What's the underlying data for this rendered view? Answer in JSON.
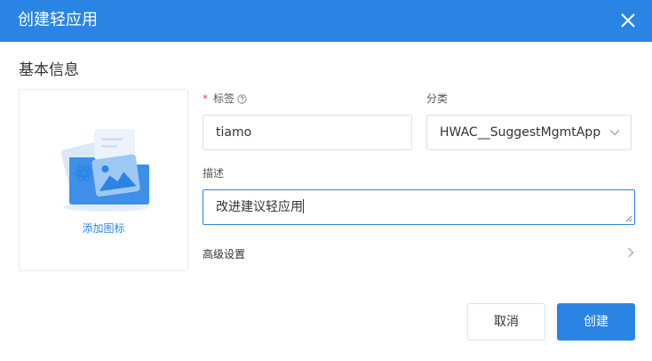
{
  "dialog": {
    "title": "创建轻应用"
  },
  "section": {
    "basic_info": "基本信息"
  },
  "icon_upload": {
    "label": "添加图标"
  },
  "form": {
    "tag": {
      "required_mark": "*",
      "label": "标签",
      "value": "tiamo"
    },
    "category": {
      "label": "分类",
      "selected": "HWAC__SuggestMgmtApp"
    },
    "description": {
      "label": "描述",
      "value": "改进建议轻应用"
    },
    "advanced": {
      "label": "高级设置"
    }
  },
  "footer": {
    "cancel_label": "取消",
    "create_label": "创建"
  },
  "colors": {
    "accent": "#2a84e4",
    "required": "#e5484d"
  },
  "icons": {
    "close": "close-icon",
    "help": "help-icon",
    "chevron_down": "chevron-down-icon",
    "chevron_right": "chevron-right-icon",
    "upload_art": "image-folder-icon"
  }
}
